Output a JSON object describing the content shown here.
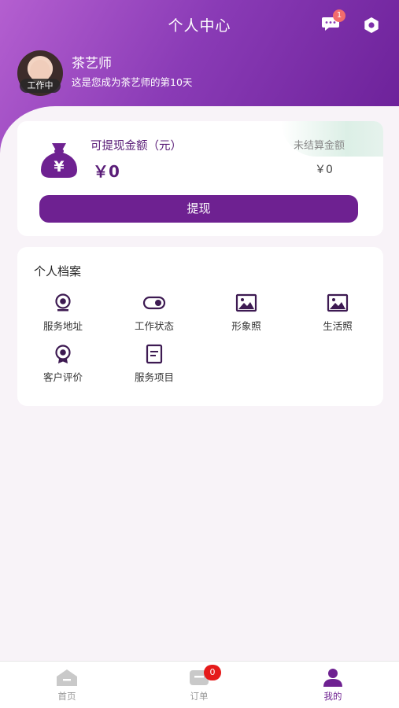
{
  "header": {
    "title": "个人中心",
    "message_badge": "1",
    "icons": {
      "messages": "chat-bubble-icon",
      "settings": "gear-icon"
    }
  },
  "user": {
    "name": "茶艺师",
    "status_badge": "工作中",
    "days_text": "这是您成为茶艺师的第10天"
  },
  "wallet": {
    "withdrawable_label": "可提现金额（元）",
    "withdrawable_amount": "￥0",
    "unsettled_label": "未结算金额",
    "unsettled_amount": "￥0",
    "withdraw_button": "提现",
    "icon": "money-bag-icon"
  },
  "profile": {
    "title": "个人档案",
    "items": [
      {
        "label": "服务地址",
        "icon": "location-icon"
      },
      {
        "label": "工作状态",
        "icon": "toggle-icon"
      },
      {
        "label": "形象照",
        "icon": "image-icon"
      },
      {
        "label": "生活照",
        "icon": "image-icon"
      },
      {
        "label": "客户评价",
        "icon": "badge-icon"
      },
      {
        "label": "服务项目",
        "icon": "document-icon"
      }
    ]
  },
  "tabbar": {
    "tabs": [
      {
        "label": "首页",
        "icon": "home-icon",
        "active": false
      },
      {
        "label": "订单",
        "icon": "order-icon",
        "active": false,
        "badge": "0"
      },
      {
        "label": "我的",
        "icon": "person-icon",
        "active": true
      }
    ]
  },
  "colors": {
    "primary": "#6e2191",
    "header_gradient_start": "#b45fd0",
    "header_gradient_end": "#6a1f97",
    "badge_red": "#e51a1a"
  }
}
